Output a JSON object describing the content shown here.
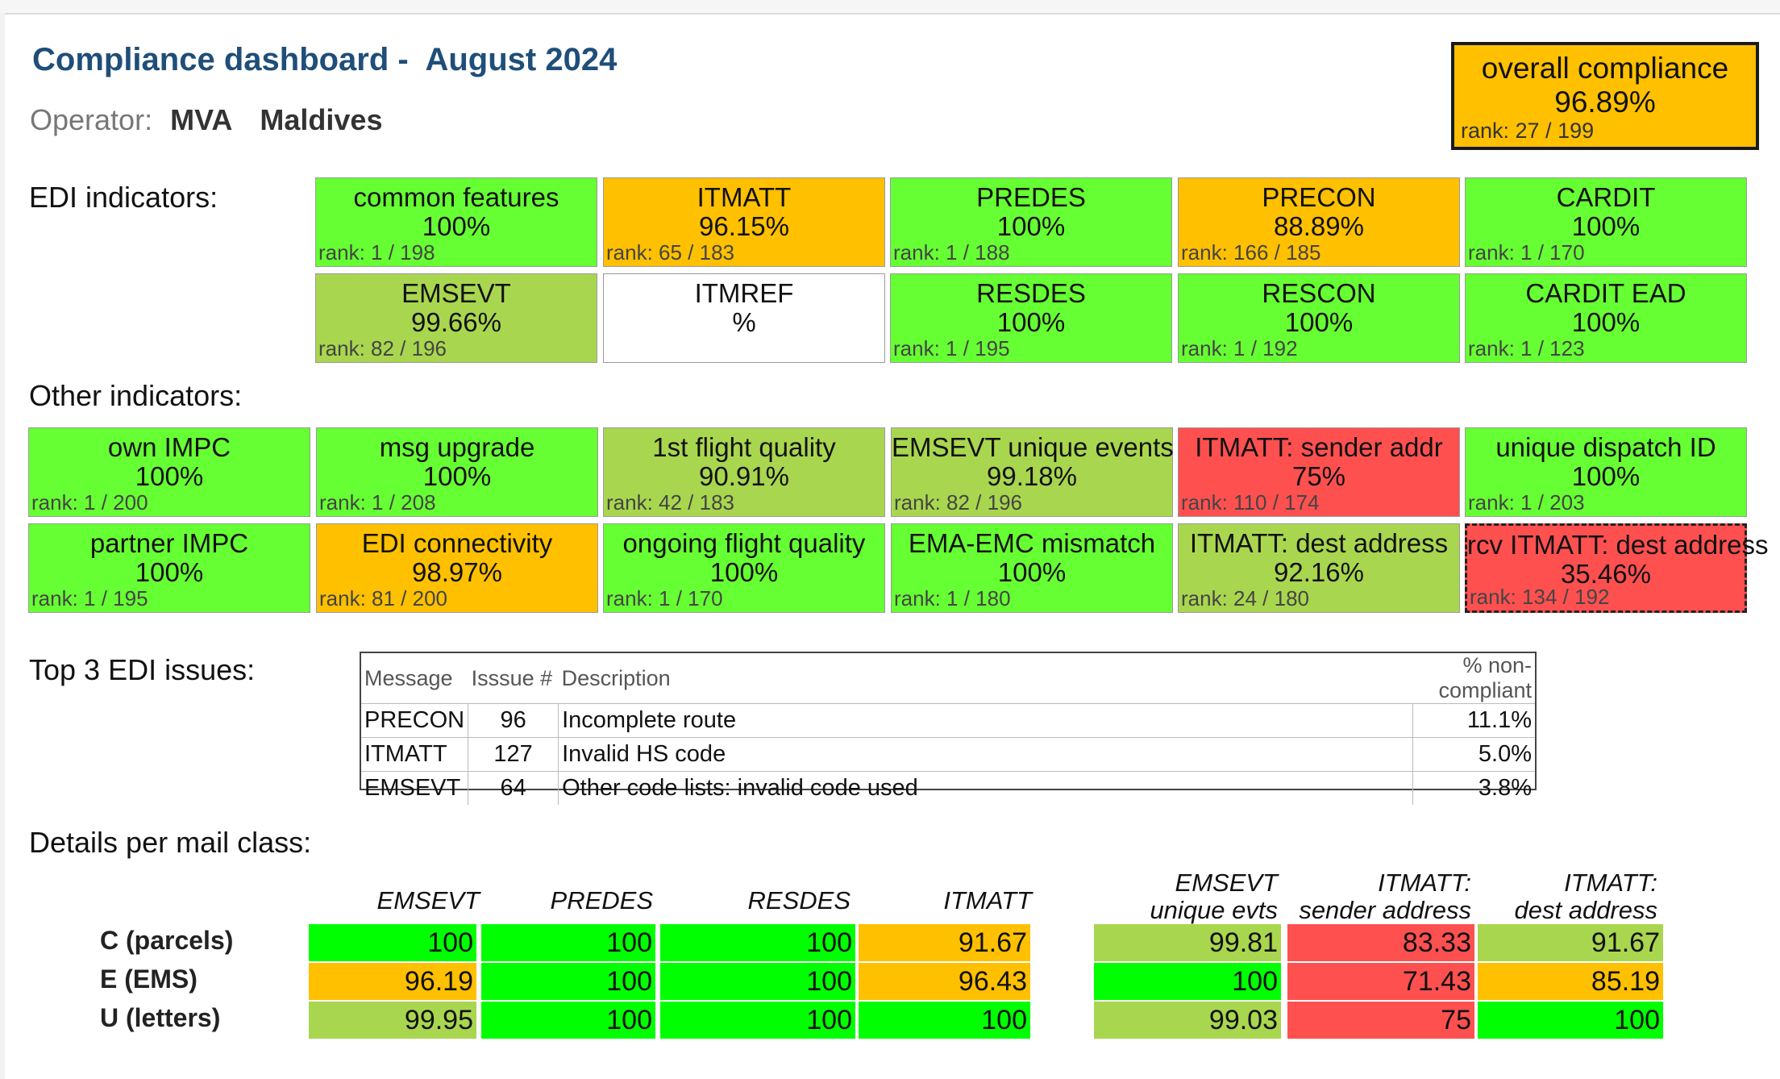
{
  "header": {
    "title": "Compliance dashboard -  August 2024",
    "operator_label": "Operator:",
    "operator_code": "MVA",
    "operator_country": "Maldives"
  },
  "overall": {
    "label": "overall compliance",
    "value": "96.89%",
    "rank": "rank: 27 / 199",
    "color": "#ffc000"
  },
  "colors": {
    "green": "#66ff33",
    "light_green": "#a9d64f",
    "amber": "#ffc000",
    "red": "#ff5050",
    "white": "#ffffff",
    "bright_green": "#00ff00"
  },
  "edi": {
    "label": "EDI indicators:",
    "tiles": [
      {
        "name": "common features",
        "value": "100%",
        "rank": "rank: 1 / 198",
        "color": "#66ff33"
      },
      {
        "name": "ITMATT",
        "value": "96.15%",
        "rank": "rank: 65 / 183",
        "color": "#ffc000"
      },
      {
        "name": "PREDES",
        "value": "100%",
        "rank": "rank: 1 / 188",
        "color": "#66ff33"
      },
      {
        "name": "PRECON",
        "value": "88.89%",
        "rank": "rank: 166 / 185",
        "color": "#ffc000"
      },
      {
        "name": "CARDIT",
        "value": "100%",
        "rank": "rank: 1 / 170",
        "color": "#66ff33"
      },
      {
        "name": "EMSEVT",
        "value": "99.66%",
        "rank": "rank: 82 / 196",
        "color": "#a9d64f"
      },
      {
        "name": "ITMREF",
        "value": "%",
        "rank": "",
        "color": "#ffffff"
      },
      {
        "name": "RESDES",
        "value": "100%",
        "rank": "rank: 1 / 195",
        "color": "#66ff33"
      },
      {
        "name": "RESCON",
        "value": "100%",
        "rank": "rank: 1 / 192",
        "color": "#66ff33"
      },
      {
        "name": "CARDIT EAD",
        "value": "100%",
        "rank": "rank: 1 / 123",
        "color": "#66ff33"
      }
    ]
  },
  "other": {
    "label": "Other indicators:",
    "tiles": [
      {
        "name": "own IMPC",
        "value": "100%",
        "rank": "rank: 1 / 200",
        "color": "#66ff33"
      },
      {
        "name": "msg upgrade",
        "value": "100%",
        "rank": "rank: 1 / 208",
        "color": "#66ff33"
      },
      {
        "name": "1st flight quality",
        "value": "90.91%",
        "rank": "rank: 42 / 183",
        "color": "#a9d64f"
      },
      {
        "name": "EMSEVT unique events",
        "value": "99.18%",
        "rank": "rank: 82 / 196",
        "color": "#a9d64f"
      },
      {
        "name": "ITMATT: sender addr",
        "value": "75%",
        "rank": "rank: 110 / 174",
        "color": "#ff5050"
      },
      {
        "name": "unique dispatch ID",
        "value": "100%",
        "rank": "rank: 1 / 203",
        "color": "#66ff33"
      },
      {
        "name": "partner IMPC",
        "value": "100%",
        "rank": "rank: 1 / 195",
        "color": "#66ff33"
      },
      {
        "name": "EDI connectivity",
        "value": "98.97%",
        "rank": "rank: 81 / 200",
        "color": "#ffc000"
      },
      {
        "name": "ongoing flight quality",
        "value": "100%",
        "rank": "rank: 1 / 170",
        "color": "#66ff33"
      },
      {
        "name": "EMA-EMC mismatch",
        "value": "100%",
        "rank": "rank: 1 / 180",
        "color": "#66ff33"
      },
      {
        "name": "ITMATT: dest address",
        "value": "92.16%",
        "rank": "rank: 24 / 180",
        "color": "#a9d64f"
      },
      {
        "name": "rcv ITMATT: dest address",
        "value": "35.46%",
        "rank": "rank: 134 / 192",
        "color": "#ff5050"
      }
    ]
  },
  "issues": {
    "label": "Top 3 EDI issues:",
    "headers": [
      "Message",
      "Isssue #",
      "Description",
      "% non-compliant"
    ],
    "rows": [
      [
        "PRECON",
        "96",
        "Incomplete route",
        "11.1%"
      ],
      [
        "ITMATT",
        "127",
        "Invalid HS code",
        "5.0%"
      ],
      [
        "EMSEVT",
        "64",
        "Other code lists: invalid code used",
        "3.8%"
      ]
    ]
  },
  "mail_class": {
    "label": "Details per mail class:",
    "group1_headers": [
      "EMSEVT",
      "PREDES",
      "RESDES",
      "ITMATT"
    ],
    "group2_headers": [
      [
        "EMSEVT",
        "unique evts"
      ],
      [
        "ITMATT:",
        "sender address"
      ],
      [
        "ITMATT:",
        "dest address"
      ]
    ],
    "rows": [
      {
        "label": "C (parcels)",
        "g1": [
          {
            "v": "100",
            "color": "#00ff00"
          },
          {
            "v": "100",
            "color": "#00ff00"
          },
          {
            "v": "100",
            "color": "#00ff00"
          },
          {
            "v": "91.67",
            "color": "#ffc000"
          }
        ],
        "g2": [
          {
            "v": "99.81",
            "color": "#a9d64f"
          },
          {
            "v": "83.33",
            "color": "#ff5050"
          },
          {
            "v": "91.67",
            "color": "#a9d64f"
          }
        ]
      },
      {
        "label": "E (EMS)",
        "g1": [
          {
            "v": "96.19",
            "color": "#ffc000"
          },
          {
            "v": "100",
            "color": "#00ff00"
          },
          {
            "v": "100",
            "color": "#00ff00"
          },
          {
            "v": "96.43",
            "color": "#ffc000"
          }
        ],
        "g2": [
          {
            "v": "100",
            "color": "#00ff00"
          },
          {
            "v": "71.43",
            "color": "#ff5050"
          },
          {
            "v": "85.19",
            "color": "#ffc000"
          }
        ]
      },
      {
        "label": "U (letters)",
        "g1": [
          {
            "v": "99.95",
            "color": "#a9d64f"
          },
          {
            "v": "100",
            "color": "#00ff00"
          },
          {
            "v": "100",
            "color": "#00ff00"
          },
          {
            "v": "100",
            "color": "#00ff00"
          }
        ],
        "g2": [
          {
            "v": "99.03",
            "color": "#a9d64f"
          },
          {
            "v": "75",
            "color": "#ff5050"
          },
          {
            "v": "100",
            "color": "#00ff00"
          }
        ]
      }
    ]
  }
}
